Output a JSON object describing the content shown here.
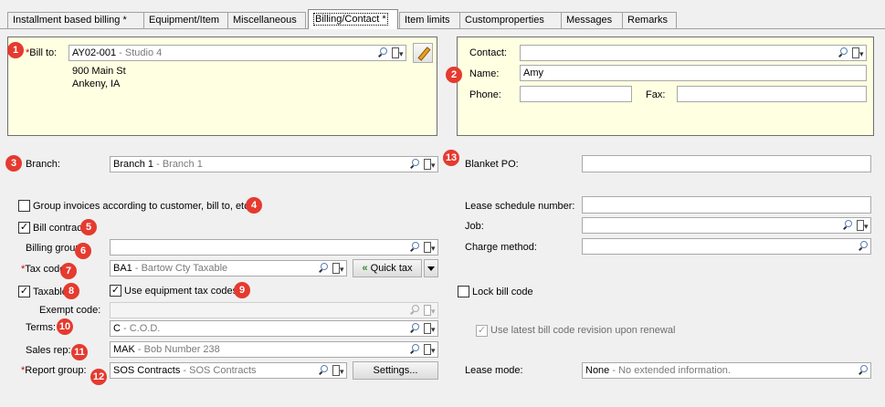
{
  "tabs": [
    {
      "label": "Installment based billing *"
    },
    {
      "label": "Equipment/Item"
    },
    {
      "label": "Miscellaneous"
    },
    {
      "label": "Billing/Contact *"
    },
    {
      "label": "Item limits"
    },
    {
      "label": "Customproperties"
    },
    {
      "label": "Messages"
    },
    {
      "label": "Remarks"
    }
  ],
  "bill_to": {
    "required_mark": "*",
    "label": "Bill to:",
    "code": "AY02-001",
    "desc": "Studio 4",
    "address_line1": "900 Main St",
    "address_line2": "Ankeny, IA"
  },
  "contact": {
    "contact_label": "Contact:",
    "contact_value": "",
    "name_label": "Name:",
    "name_value": "Amy",
    "phone_label": "Phone:",
    "phone_value": "",
    "fax_label": "Fax:",
    "fax_value": ""
  },
  "branch": {
    "label": "Branch:",
    "code": "Branch 1",
    "desc": "Branch 1"
  },
  "blanket_po": {
    "label": "Blanket PO:",
    "value": ""
  },
  "group_invoices": {
    "label": "Group invoices according to customer, bill to, etc.",
    "checked": false
  },
  "lease_schedule": {
    "label": "Lease schedule number:",
    "value": ""
  },
  "bill_contract": {
    "label": "Bill contract",
    "checked": true
  },
  "job": {
    "label": "Job:",
    "value": ""
  },
  "billing_group": {
    "label": "Billing group:",
    "value": ""
  },
  "charge_method": {
    "label": "Charge method:",
    "value": ""
  },
  "tax_code": {
    "required_mark": "*",
    "label": "Tax code:",
    "code": "BA1",
    "desc": "Bartow Cty Taxable"
  },
  "quick_tax": {
    "label": "Quick tax",
    "arrows": "«"
  },
  "taxable": {
    "label": "Taxable",
    "checked": true
  },
  "use_equipment_tax": {
    "label": "Use equipment tax codes",
    "checked": true
  },
  "lock_bill_code": {
    "label": "Lock bill code",
    "checked": false
  },
  "exempt_code": {
    "label": "Exempt code:",
    "value": ""
  },
  "terms": {
    "label": "Terms:",
    "code": "C",
    "desc": "C.O.D."
  },
  "use_latest": {
    "label": "Use latest bill code revision upon renewal",
    "checked": true
  },
  "sales_rep": {
    "label": "Sales rep:",
    "code": "MAK",
    "desc": "Bob Number 238"
  },
  "report_group": {
    "required_mark": "*",
    "label": "Report group:",
    "code": "SOS Contracts",
    "desc": "SOS Contracts"
  },
  "settings_button": {
    "label": "Settings..."
  },
  "lease_mode": {
    "label": "Lease mode:",
    "code": "None",
    "desc": "No extended information."
  },
  "check_mark": "✓",
  "desc_separator": " - ",
  "badges": [
    "1",
    "2",
    "3",
    "4",
    "5",
    "6",
    "7",
    "8",
    "9",
    "10",
    "11",
    "12",
    "13"
  ],
  "colors": {
    "panel_bg": "#ffffe1",
    "badge": "#e53a2f",
    "required": "#cc0000",
    "quick_tax_arrow": "#2e8b2e"
  }
}
